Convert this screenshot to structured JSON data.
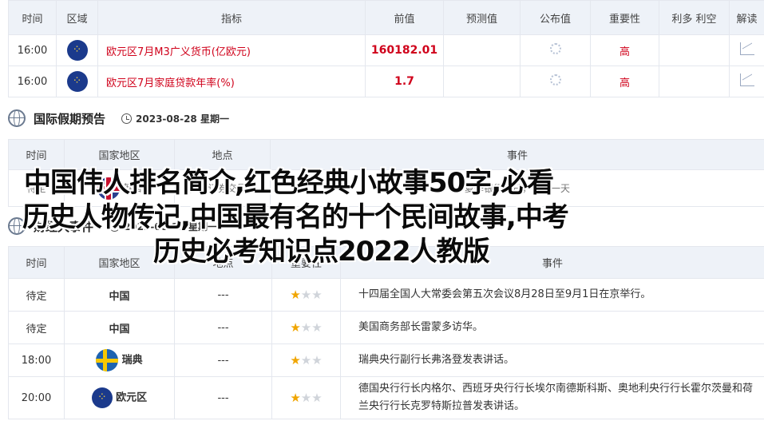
{
  "calendar": {
    "headers": [
      "时间",
      "区域",
      "指标",
      "前值",
      "预测值",
      "公布值",
      "重要性",
      "利多 利空",
      "解读"
    ],
    "rows": [
      {
        "time": "16:00",
        "region_icon": "eu-flag-icon",
        "indicator": "欧元区7月M3广义货币(亿欧元)",
        "previous": "160182.01",
        "importance": "高"
      },
      {
        "time": "16:00",
        "region_icon": "eu-flag-icon",
        "indicator": "欧元区7月家庭贷款年率(%)",
        "previous": "1.7",
        "importance": "高"
      }
    ]
  },
  "holidays": {
    "title": "国际假期预告",
    "date": "2023-08-28 星期一",
    "headers": [
      "时间",
      "国家地区",
      "地点",
      "事件"
    ],
    "rows": [
      {
        "time": "待定",
        "region_icon": "uk-flag-icon",
        "country": "英国",
        "place": "伦敦证券交易所",
        "event": "夏季银行假日，休市一天"
      }
    ]
  },
  "events": {
    "title": "财经大事件",
    "date": "2023-08-28 星期一",
    "headers": [
      "时间",
      "国家地区",
      "地点",
      "重要性",
      "事件"
    ],
    "rows": [
      {
        "time": "待定",
        "country": "中国",
        "place": "---",
        "stars": 1,
        "event": "十四届全国人大常委会第五次会议8月28日至9月1日在京举行。"
      },
      {
        "time": "待定",
        "country": "中国",
        "place": "---",
        "stars": 1,
        "event": "美国商务部长雷蒙多访华。"
      },
      {
        "time": "18:00",
        "country": "瑞典",
        "region_icon": "se-flag-icon",
        "place": "---",
        "stars": 1,
        "event": "瑞典央行副行长弗洛登发表讲话。"
      },
      {
        "time": "20:00",
        "country": "欧元区",
        "region_icon": "eu-flag-icon",
        "place": "---",
        "stars": 1,
        "event": "德国央行行长内格尔、西班牙央行行长埃尔南德斯科斯、奥地利央行行长霍尔茨曼和荷兰央行行长克罗特斯拉普发表讲话。"
      }
    ]
  },
  "overlay": {
    "line1": "中国伟人排名简介,红色经典小故事50字,必看",
    "line2": "历史人物传记,中国最有名的十个民间故事,中考",
    "line3": "历史必考知识点2022人教版"
  }
}
